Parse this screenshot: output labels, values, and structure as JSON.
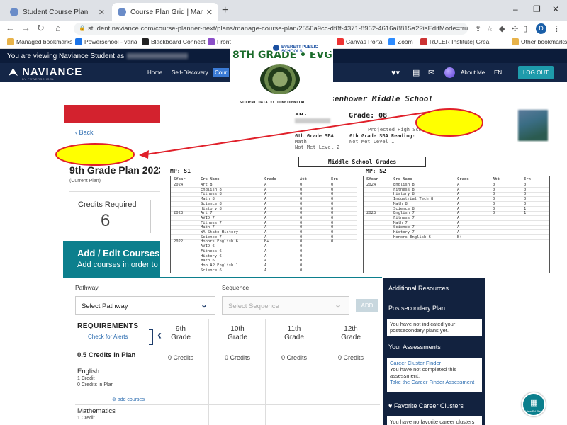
{
  "browser": {
    "tabs": [
      {
        "title": "Student Course Plan",
        "active": false
      },
      {
        "title": "Course Plan Grid | Manage Cou",
        "active": true
      }
    ],
    "url": "student.naviance.com/course-planner-next/plans/manage-course-plan/2556a9cc-df8f-4371-8962-4616a8815a2?isEditMode=true",
    "bookmarks": [
      "Managed bookmarks",
      "Powerschool - varia",
      "Blackboard Connect",
      "Front",
      "Canvas Portal",
      "Zoom",
      "RULER Institute| Grea",
      "Other bookmarks"
    ]
  },
  "naviance": {
    "viewing_prefix": "You are viewing Naviance Student as",
    "brand": "NAVIANCE",
    "brand_sub": "BY POWERSCHOOL",
    "nav": [
      "Home",
      "Self-Discovery",
      "Cour"
    ],
    "about_me": "About Me",
    "lang": "EN",
    "logout": "LOG OUT",
    "back": "Back",
    "plan_title": "9th Grade Plan 2023-",
    "plan_sub": "(Current Plan)",
    "credits_required_label": "Credits Required",
    "credits_required_value": "6",
    "add_edit_title": "Add / Edit Courses in",
    "add_edit_sub": "Add courses in order to s",
    "pathway_label": "Pathway",
    "pathway_value": "Select Pathway",
    "sequence_label": "Sequence",
    "sequence_value": "Select Sequence",
    "add_btn": "ADD",
    "requirements": "REQUIREMENTS",
    "check_alerts": "Check for Alerts",
    "credits_in_plan": "0.5 Credits in Plan",
    "grades": [
      {
        "line1": "9th",
        "line2": "Grade",
        "credits": "0 Credits"
      },
      {
        "line1": "10th",
        "line2": "Grade",
        "credits": "0 Credits"
      },
      {
        "line1": "11th",
        "line2": "Grade",
        "credits": "0 Credits"
      },
      {
        "line1": "12th",
        "line2": "Grade",
        "credits": "0 Credits"
      }
    ],
    "subjects": [
      {
        "name": "English",
        "l1": "1 Credit",
        "l2": "0 Credits in Plan",
        "add": "add courses"
      },
      {
        "name": "Mathematics",
        "l1": "1 Credit"
      }
    ],
    "sidebar": {
      "additional": "Additional Resources",
      "postsec": "Postsecondary Plan",
      "postsec_msg": "You have not indicated your postsecondary plans yet.",
      "assessments": "Your Assessments",
      "ccf_title": "Career Cluster Finder",
      "ccf_msg": "You have not completed this assessment.",
      "ccf_link": "Take the Career Finder Assessment",
      "fav": "Favorite Career Clusters",
      "fav_msg": "You have no favorite career clusters"
    },
    "fab_text": "View Pd Plan"
  },
  "transcript": {
    "school": "Eisenhower Middle School",
    "id_label": "ID:",
    "grade_label": "Grade: 08",
    "counselor_line": "Projected High School: Cascade",
    "sba_math": "Math",
    "sba_math_val": "Not Met Level 2",
    "sba_reading_label": "6th Grade SBA Reading:",
    "sba_reading_val": "Not Met Level 1",
    "sba_label": "6th Grade SBA",
    "section_title": "Middle School Grades",
    "sem1": "MP: S1",
    "sem2": "MP: S2",
    "col_headers": [
      "SYear",
      "Crs Name",
      "Grade",
      "Att",
      "Ern"
    ],
    "s1_rows": [
      {
        "year": "2024",
        "crs": "Art 8",
        "grd": "A",
        "att": "0",
        "ern": "0"
      },
      {
        "year": "",
        "crs": "English 8",
        "grd": "A",
        "att": "0",
        "ern": "0"
      },
      {
        "year": "",
        "crs": "Fitness 8",
        "grd": "A",
        "att": "0",
        "ern": "0"
      },
      {
        "year": "",
        "crs": "Math 8",
        "grd": "A",
        "att": "0",
        "ern": "0"
      },
      {
        "year": "",
        "crs": "Science 8",
        "grd": "A",
        "att": "0",
        "ern": "0"
      },
      {
        "year": "",
        "crs": "History 8",
        "grd": "A",
        "att": "0",
        "ern": "0"
      },
      {
        "year": "2023",
        "crs": "Art 7",
        "grd": "A",
        "att": "0",
        "ern": "0"
      },
      {
        "year": "",
        "crs": "AVID 7",
        "grd": "A",
        "att": "0",
        "ern": "0"
      },
      {
        "year": "",
        "crs": "Fitness 7",
        "grd": "A",
        "att": "0",
        "ern": "0"
      },
      {
        "year": "",
        "crs": "Math 7",
        "grd": "A",
        "att": "0",
        "ern": "0"
      },
      {
        "year": "",
        "crs": "WA State History",
        "grd": "A",
        "att": "0",
        "ern": "0"
      },
      {
        "year": "",
        "crs": "Science 7",
        "grd": "A",
        "att": "0",
        "ern": "0"
      },
      {
        "year": "2022",
        "crs": "Honors English 6",
        "grd": "B+",
        "att": "0",
        "ern": "0"
      },
      {
        "year": "",
        "crs": "AVID 6",
        "grd": "A",
        "att": "0",
        "ern": ""
      },
      {
        "year": "",
        "crs": "Fitness 6",
        "grd": "A",
        "att": "0",
        "ern": ""
      },
      {
        "year": "",
        "crs": "History 6",
        "grd": "A",
        "att": "0",
        "ern": ""
      },
      {
        "year": "",
        "crs": "Math 6",
        "grd": "A",
        "att": "0",
        "ern": ""
      },
      {
        "year": "",
        "crs": "Hon AP English 1",
        "grd": "A",
        "att": "0",
        "ern": ""
      },
      {
        "year": "",
        "crs": "Science 6",
        "grd": "A",
        "att": "0",
        "ern": ""
      }
    ],
    "s2_rows": [
      {
        "year": "2024",
        "crs": "English 8",
        "grd": "A",
        "att": "0",
        "ern": "0"
      },
      {
        "year": "",
        "crs": "Fitness 8",
        "grd": "A",
        "att": "0",
        "ern": "0"
      },
      {
        "year": "",
        "crs": "History 8",
        "grd": "A",
        "att": "0",
        "ern": "0"
      },
      {
        "year": "",
        "crs": "Industrial Tech 8",
        "grd": "A",
        "att": "0",
        "ern": "0"
      },
      {
        "year": "",
        "crs": "Math 8",
        "grd": "A",
        "att": "0",
        "ern": "0"
      },
      {
        "year": "",
        "crs": "Science 8",
        "grd": "A",
        "att": "0",
        "ern": "1"
      },
      {
        "year": "2023",
        "crs": "English 7",
        "grd": "A",
        "att": "0",
        "ern": "1"
      },
      {
        "year": "",
        "crs": "Fitness 7",
        "grd": "A",
        "att": "",
        "ern": ""
      },
      {
        "year": "",
        "crs": "Math 7",
        "grd": "A",
        "att": "",
        "ern": ""
      },
      {
        "year": "",
        "crs": "Science 7",
        "grd": "A",
        "att": "",
        "ern": ""
      },
      {
        "year": "",
        "crs": "History 7",
        "grd": "A",
        "att": "",
        "ern": ""
      },
      {
        "year": "",
        "crs": "Honors English 6",
        "grd": "B+",
        "att": "",
        "ern": ""
      }
    ]
  },
  "evg": {
    "district": "EVERETT PUBLIC SCHOOLS",
    "title": "8TH GRADE • EVG",
    "footer": "STUDENT DATA •• CONFIDENTIAL"
  },
  "colors": {
    "navy": "#142647",
    "teal": "#0c7f8d",
    "red": "#d3222e",
    "highlight": "#ffff00",
    "arrow": "#e0202a"
  }
}
